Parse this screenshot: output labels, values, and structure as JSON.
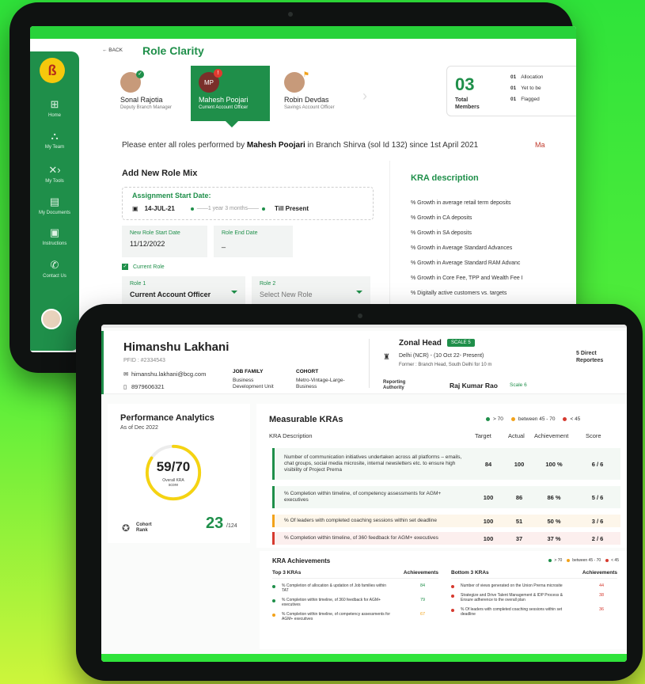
{
  "back": {
    "sidebar": [
      {
        "icon": "⊞",
        "label": "Home"
      },
      {
        "icon": "⛬",
        "label": "My Team"
      },
      {
        "icon": "✕›",
        "label": "My Tools"
      },
      {
        "icon": "▤",
        "label": "My Documents"
      },
      {
        "icon": "▣",
        "label": "Instructions"
      },
      {
        "icon": "✆",
        "label": "Contact Us"
      }
    ],
    "back_label": "← BACK",
    "title": "Role Clarity",
    "members": [
      {
        "name": "Sonal Rajotia",
        "role": "Deputy Branch Manager"
      },
      {
        "name": "Mahesh Poojari",
        "role": "Current Account Officer",
        "initials": "MP",
        "alert": "!"
      },
      {
        "name": "Robin Devdas",
        "role": "Savings Account Officer"
      }
    ],
    "summary": {
      "count": "03",
      "label": "Total Members",
      "rows": [
        {
          "n": "01",
          "t": "Allocation"
        },
        {
          "n": "01",
          "t": "Yet to be"
        },
        {
          "n": "01",
          "t": "Flagged"
        }
      ]
    },
    "info": {
      "pre": "Please enter all roles performed by ",
      "name": "Mahesh Poojari",
      "post": " in Branch Shirva (sol Id 132) since 1st April 2021",
      "more": "Ma"
    },
    "add_role_title": "Add New Role Mix",
    "assignment": {
      "title": "Assignment Start Date:",
      "start": "14-JUL-21",
      "duration": "1 year 3 months",
      "end": "Till Present"
    },
    "new_role_start": {
      "label": "New Role Start Date",
      "value": "11/12/2022"
    },
    "role_end": {
      "label": "Role End Date",
      "value": "_"
    },
    "current_role_label": "Current Role",
    "role1": {
      "label": "Role 1",
      "value": "Current Account Officer"
    },
    "role2": {
      "label": "Role 2",
      "value": "Select New Role"
    },
    "kra_title": "KRA description",
    "kra_items": [
      "% Growth in average retail term deposits",
      "% Growth in CA deposits",
      "% Growth in SA deposits",
      "% Growth in Average Standard Advances",
      "% Growth in Average Standard RAM Advanc",
      "% Growth in Core Fee, TPP and Wealth Fee I",
      "% Digitally active customers vs. targets"
    ]
  },
  "front": {
    "profile": {
      "name": "Himanshu Lakhani",
      "pfid": "PFID : #2334543",
      "email": "himanshu.lakhani@bcg.com",
      "phone": "8979606321",
      "job_family_label": "JOB FAMILY",
      "job_family": "Business Development Unit",
      "cohort_label": "COHORT",
      "cohort": "Metro-Vintage-Large-Business"
    },
    "zone": {
      "title": "Zonal Head",
      "scale": "SCALE 5",
      "location": "Delhi (NCR) - (10 Oct 22- Present)",
      "former": "Former : Branch Head, South Delhi for 10 m",
      "direct": "5 Direct Reportees",
      "reporting_label": "Reporting Authority",
      "reporting_name": "Raj Kumar Rao",
      "reporting_scale": "Scale 6"
    },
    "performance": {
      "title": "Performance Analytics",
      "as_of": "As of Dec 2022",
      "score": "59/70",
      "score_label": "Overall KRA score",
      "score_value": 59,
      "score_max": 70,
      "cohort_label": "Cohort Rank",
      "cohort_rank": "23",
      "cohort_total": "/124"
    },
    "legend": {
      "green": "> 70",
      "orange": "between 45 - 70",
      "red": "< 45",
      "colors": {
        "green": "#1f8f4a",
        "orange": "#f2a21a",
        "red": "#d63a2f"
      }
    },
    "kras": {
      "title": "Measurable KRAs",
      "headers": {
        "desc": "KRA Description",
        "target": "Target",
        "actual": "Actual",
        "achievement": "Achievement",
        "score": "Score"
      },
      "rows": [
        {
          "desc": "Number of communication initiatives undertaken across all platforms – emails, chat groups, social media microsite, internal newsletters etc. to ensure high visibility of Project Prerna",
          "target": "84",
          "actual": "100",
          "achievement": "100 %",
          "score": "6 / 6",
          "status": "green"
        },
        {
          "desc": "% Completion within timeline, of competency assessments for AGM+ executives",
          "target": "100",
          "actual": "86",
          "achievement": "86 %",
          "score": "5 / 6",
          "status": "green"
        },
        {
          "desc": "% Of leaders with completed coaching sessions within set deadline",
          "target": "100",
          "actual": "51",
          "achievement": "50 %",
          "score": "3 / 6",
          "status": "orange"
        },
        {
          "desc": "% Completion within timeline, of 360 feedback for AGM+ executives",
          "target": "100",
          "actual": "37",
          "achievement": "37 %",
          "score": "2 / 6",
          "status": "red"
        }
      ]
    },
    "achievements": {
      "title": "KRA Achievements",
      "top_label": "Top 3 KRAs",
      "bottom_label": "Bottom 3 KRAs",
      "col_label": "Achievements",
      "top": [
        {
          "text": "% Completion of allocation & updation of Job families within TAT",
          "value": "84",
          "status": "green"
        },
        {
          "text": "% Completion within timeline, of 360 feedback for AGM+ executives",
          "value": "79",
          "status": "green"
        },
        {
          "text": "% Completion within timeline, of competency assessments for AGM+ executives",
          "value": "67",
          "status": "orange"
        }
      ],
      "bottom": [
        {
          "text": "Number of views generated on the Union Prerna microsite",
          "value": "44",
          "status": "red"
        },
        {
          "text": "Strategize and Drive Talent Management & IDP Process & Ensure adherence to the overall plan",
          "value": "38",
          "status": "red"
        },
        {
          "text": "% Of leaders with completed coaching sessions within set deadline",
          "value": "36",
          "status": "red"
        }
      ]
    }
  }
}
